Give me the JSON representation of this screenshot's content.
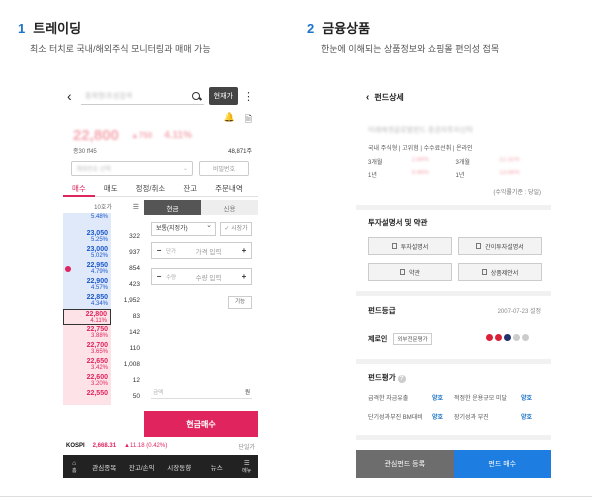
{
  "sections": [
    {
      "num": "1",
      "title": "트레이딩",
      "desc": "최소 터치로 국내/해외주식 모니터링과 매매 가능"
    },
    {
      "num": "2",
      "title": "금융상품",
      "desc": "한눈에 이해되는 상품정보와 쇼핑몰 편의성 접목"
    }
  ],
  "trading": {
    "search_placeholder": "종목명/초성검색",
    "current_price_btn": "현재가",
    "more": "⋮",
    "price": "22,800",
    "change": "▲750",
    "rate": "4.11%",
    "sub_info": "종30  ff45",
    "volume": "48,871주",
    "account_placeholder": "계좌번호 선택",
    "password_btn": "비밀번호",
    "tabs": [
      "매수",
      "매도",
      "정정/취소",
      "잔고",
      "주문내역"
    ],
    "orderbook_head": "10호가",
    "orderbook_menu": "☰",
    "orderbook": [
      {
        "price": "",
        "pct": "5.48%",
        "qty": ""
      },
      {
        "price": "23,050",
        "pct": "5.25%",
        "qty": "322"
      },
      {
        "price": "23,000",
        "pct": "5.02%",
        "qty": "937"
      },
      {
        "price": "22,950",
        "pct": "4.79%",
        "qty": "854"
      },
      {
        "price": "22,900",
        "pct": "4.57%",
        "qty": "423"
      },
      {
        "price": "22,850",
        "pct": "4.34%",
        "qty": "1,952"
      },
      {
        "price": "22,800",
        "pct": "4.11%",
        "qty": "83"
      },
      {
        "price": "22,750",
        "pct": "3.88%",
        "qty": "142"
      },
      {
        "price": "22,700",
        "pct": "3.65%",
        "qty": "110"
      },
      {
        "price": "22,650",
        "pct": "3.42%",
        "qty": "1,008"
      },
      {
        "price": "22,600",
        "pct": "3.20%",
        "qty": "12"
      },
      {
        "price": "22,550",
        "pct": "",
        "qty": "50"
      }
    ],
    "order_tabs": [
      "현금",
      "신용"
    ],
    "order_type": "보통(지정가)",
    "market_chk": "시장가",
    "price_label": "단가",
    "price_placeholder": "가격 입력",
    "qty_label": "수량",
    "qty_placeholder": "수량 입력",
    "func_btn": "기능",
    "amount_label": "금액",
    "amount_unit": "원",
    "buy_btn": "현금매수",
    "kospi_label": "KOSPI",
    "kospi_value": "2,668.31",
    "kospi_change": "▲11.18 (0.42%)",
    "kospi_right": "단일가",
    "bottom_nav": [
      "홈",
      "관심종목",
      "잔고/손익",
      "시장동향",
      "뉴스",
      "메뉴"
    ]
  },
  "fund": {
    "title": "펀드상세",
    "fund_name": "미래에셋글로벌펀드 증권자투자신탁",
    "sub": "국내 주식형 | 고위험 | 수수료선취 | 온라인",
    "perf": [
      {
        "l": "3개월",
        "v": "2.84%",
        "l2": "3개월",
        "v2": "12.31%"
      },
      {
        "l": "1년",
        "v": "9.46%",
        "l2": "1년",
        "v2": "13.84%"
      }
    ],
    "basis": "(수익률기준 : 당일)",
    "docs_title": "투자설명서 및 약관",
    "docs": [
      "투자설명서",
      "간이투자설명서",
      "약관",
      "상품제안서"
    ],
    "grade_title": "펀드등급",
    "grade_date": "2007-07-23 설정",
    "grade_name": "제로인",
    "grade_tag": "외부전문평가",
    "eval_title": "펀드평가",
    "eval_icon": "?",
    "eval_rows": [
      {
        "l": "급격한 자금유출",
        "g": "양호",
        "l2": "적정한 운용규모 미달",
        "g2": "양호"
      },
      {
        "l": "단기성과부진 BM대비",
        "g": "양호",
        "l2": "장기성과 부진",
        "g2": "양호"
      }
    ],
    "btn_interest": "관심펀드 등록",
    "btn_buy": "펀드 매수",
    "colors": {
      "dot_red": "#d9213a",
      "dot_navy": "#22306b",
      "dot_gray": "#cccccc"
    }
  }
}
